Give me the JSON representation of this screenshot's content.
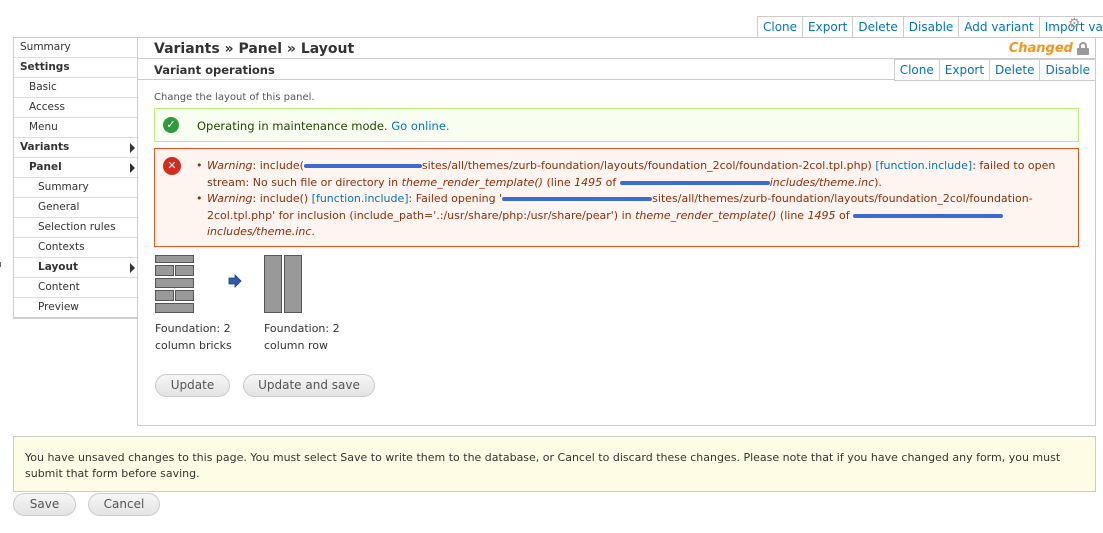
{
  "top_tabs": [
    "Clone",
    "Export",
    "Delete",
    "Disable",
    "Add variant",
    "Import variant"
  ],
  "sidebar": {
    "items": [
      {
        "label": "Summary",
        "level": 0,
        "bold": false,
        "arrow": false
      },
      {
        "label": "Settings",
        "level": 0,
        "bold": true,
        "arrow": false
      },
      {
        "label": "Basic",
        "level": 1,
        "bold": false,
        "arrow": false
      },
      {
        "label": "Access",
        "level": 1,
        "bold": false,
        "arrow": false
      },
      {
        "label": "Menu",
        "level": 1,
        "bold": false,
        "arrow": false
      },
      {
        "label": "Variants",
        "level": 0,
        "bold": true,
        "arrow": true
      },
      {
        "label": "Panel",
        "level": 1,
        "bold": true,
        "arrow": true
      },
      {
        "label": "Summary",
        "level": 2,
        "bold": false,
        "arrow": false
      },
      {
        "label": "General",
        "level": 2,
        "bold": false,
        "arrow": false
      },
      {
        "label": "Selection rules",
        "level": 2,
        "bold": false,
        "arrow": false
      },
      {
        "label": "Contexts",
        "level": 2,
        "bold": false,
        "arrow": false
      },
      {
        "label": "Layout",
        "level": 2,
        "bold": true,
        "arrow": true
      },
      {
        "label": "Content",
        "level": 2,
        "bold": false,
        "arrow": false
      },
      {
        "label": "Preview",
        "level": 2,
        "bold": false,
        "arrow": false
      }
    ]
  },
  "main": {
    "breadcrumb": "Variants » Panel » Layout",
    "changed_label": "Changed",
    "op_title": "Variant operations",
    "op_tabs": [
      "Clone",
      "Export",
      "Delete",
      "Disable"
    ],
    "description": "Change the layout of this panel.",
    "status": {
      "text": "Operating in maintenance mode.",
      "link": "Go online."
    },
    "errors": {
      "e1_warning": "Warning",
      "e1_a": ": include(",
      "e1_b": "sites/all/themes/zurb-foundation/layouts/foundation_2col/foundation-2col.tpl.php) ",
      "e1_link": "[function.include]",
      "e1_c": ": failed to open stream: No such file or directory in ",
      "e1_func": "theme_render_template()",
      "e1_d": " (line ",
      "e1_line": "1495",
      "e1_e": " of ",
      "e1_file": "includes/theme.inc",
      "e1_f": ").",
      "e2_warning": "Warning",
      "e2_a": ": include() ",
      "e2_link": "[function.include]",
      "e2_b": ": Failed opening '",
      "e2_c": "sites/all/themes/zurb-foundation/layouts/foundation_2col/foundation-2col.tpl.php' for inclusion (include_path='.:/usr/share/php:/usr/share/pear') in ",
      "e2_func": "theme_render_template()",
      "e2_d": " (line ",
      "e2_line": "1495",
      "e2_e": " of ",
      "e2_file": "includes/theme.inc",
      "e2_f": "."
    },
    "layouts": {
      "from_label": "Foundation: 2 column bricks",
      "to_label": "Foundation: 2 column row"
    },
    "buttons": {
      "update": "Update",
      "update_save": "Update and save"
    }
  },
  "notice": "You have unsaved changes to this page. You must select Save to write them to the database, or Cancel to discard these changes. Please note that if you have changed any form, you must submit that form before saving.",
  "footer_buttons": {
    "save": "Save",
    "cancel": "Cancel"
  },
  "colors": {
    "link": "#0074bd",
    "changed": "#f7941d",
    "status_ok": "#2f9a3e",
    "error_red": "#d52b1e",
    "redaction": "#3d6bd6"
  }
}
